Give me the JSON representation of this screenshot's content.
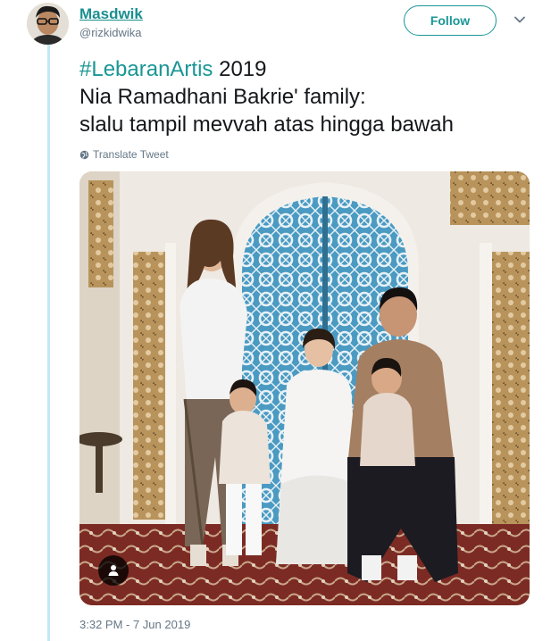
{
  "user": {
    "display_name": "Masdwik",
    "username": "@rizkidwika"
  },
  "follow_button": {
    "label": "Follow"
  },
  "tweet": {
    "hashtag": "#LebaranArtis",
    "line1_rest": " 2019",
    "line2": "Nia Ramadhani Bakrie' family:",
    "line3": "slalu tampil mevvah atas hingga bawah"
  },
  "translate": {
    "label": "Translate Tweet"
  },
  "timestamp": "3:32 PM - 7 Jun 2019",
  "colors": {
    "accent": "#1a9696",
    "thread_line": "#c4e7f7",
    "muted_text": "#657786"
  },
  "icons": {
    "caret": "chevron-down-icon",
    "translate": "globe-icon",
    "photo_tag": "person-icon"
  }
}
